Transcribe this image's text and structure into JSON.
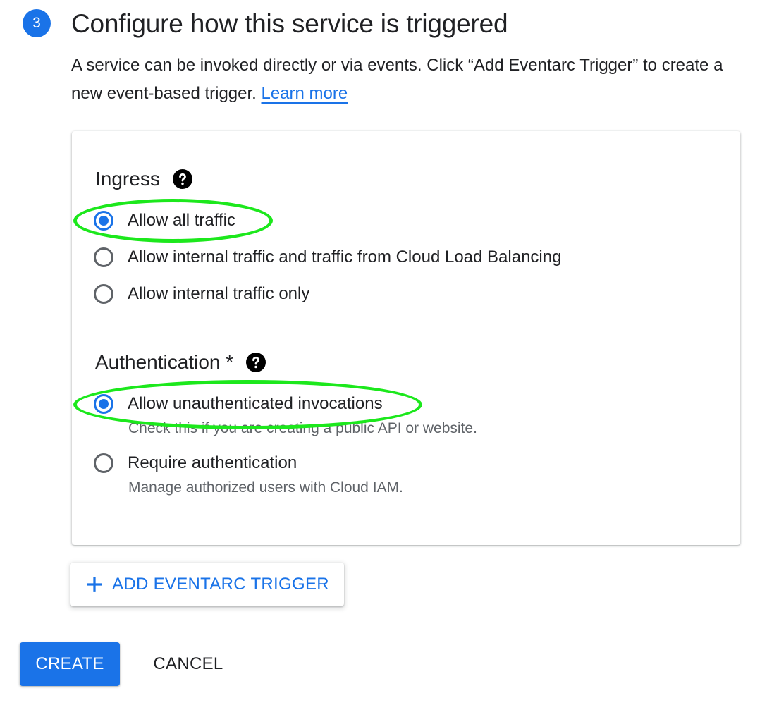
{
  "step": {
    "number": "3",
    "title": "Configure how this service is triggered",
    "description": "A service can be invoked directly or via events. Click “Add Eventarc Trigger” to create a new event-based trigger.",
    "learn_more": "Learn more"
  },
  "ingress": {
    "heading": "Ingress",
    "help_icon": "help-circle-icon",
    "options": [
      {
        "label": "Allow all traffic",
        "selected": true
      },
      {
        "label": "Allow internal traffic and traffic from Cloud Load Balancing",
        "selected": false
      },
      {
        "label": "Allow internal traffic only",
        "selected": false
      }
    ]
  },
  "authentication": {
    "heading": "Authentication *",
    "help_icon": "help-circle-icon",
    "options": [
      {
        "label": "Allow unauthenticated invocations",
        "hint": "Check this if you are creating a public API or website.",
        "selected": true
      },
      {
        "label": "Require authentication",
        "hint": "Manage authorized users with Cloud IAM.",
        "selected": false
      }
    ]
  },
  "actions": {
    "add_trigger_label": "ADD EVENTARC TRIGGER",
    "add_trigger_icon": "plus-icon",
    "create_label": "CREATE",
    "cancel_label": "CANCEL"
  },
  "colors": {
    "accent": "#1a73e8",
    "highlight": "#1ce81c",
    "text": "#202124",
    "secondary_text": "#5f6368"
  }
}
